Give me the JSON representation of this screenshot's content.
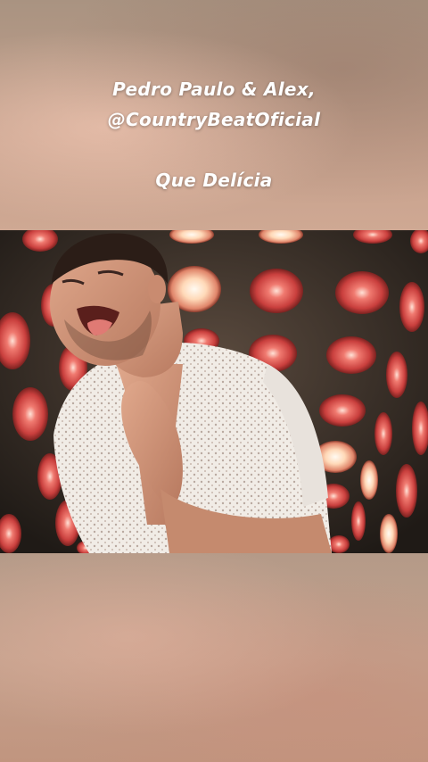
{
  "caption": {
    "artists": "Pedro Paulo & Alex,",
    "handle": "@CountryBeatOficial",
    "song": "Que Delícia"
  },
  "video": {
    "alt": "Music video frame: singer in a white lace shirt in front of a wall of red disc lights"
  },
  "colors": {
    "caption_text": "#ffffff",
    "light_red": "#d9544e",
    "light_glow": "#ffd8c8",
    "backdrop": "#2a2420"
  }
}
